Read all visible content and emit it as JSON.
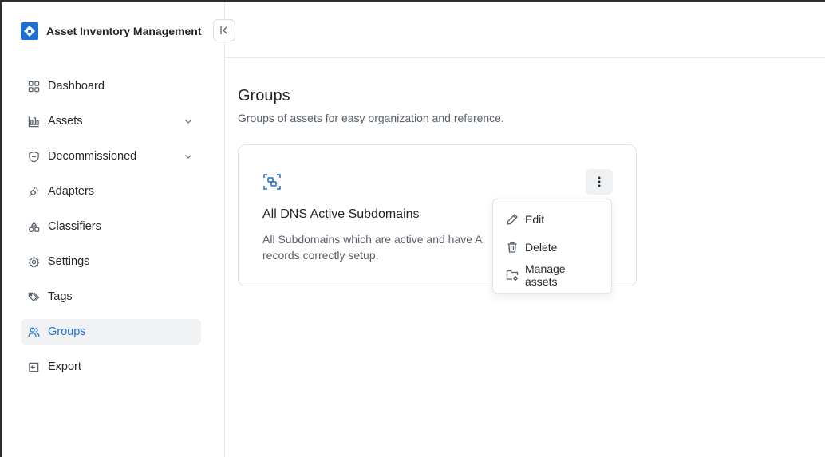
{
  "app": {
    "title": "Asset Inventory Management",
    "brand_color": "#1f6fd1"
  },
  "sidebar": {
    "items": [
      {
        "label": "Dashboard",
        "icon": "grid-icon",
        "expandable": false,
        "active": false
      },
      {
        "label": "Assets",
        "icon": "chart-icon",
        "expandable": true,
        "active": false
      },
      {
        "label": "Decommissioned",
        "icon": "shield-icon",
        "expandable": true,
        "active": false
      },
      {
        "label": "Adapters",
        "icon": "plug-icon",
        "expandable": false,
        "active": false
      },
      {
        "label": "Classifiers",
        "icon": "shapes-icon",
        "expandable": false,
        "active": false
      },
      {
        "label": "Settings",
        "icon": "gear-icon",
        "expandable": false,
        "active": false
      },
      {
        "label": "Tags",
        "icon": "tags-icon",
        "expandable": false,
        "active": false
      },
      {
        "label": "Groups",
        "icon": "users-icon",
        "expandable": false,
        "active": true
      },
      {
        "label": "Export",
        "icon": "export-icon",
        "expandable": false,
        "active": false
      }
    ]
  },
  "main": {
    "title": "Groups",
    "subtitle": "Groups of assets for easy organization and reference."
  },
  "group_card": {
    "icon": "group-icon",
    "title": "All DNS Active Subdomains",
    "description": "All Subdomains which are active and have A records correctly setup."
  },
  "context_menu": {
    "items": [
      {
        "label": "Edit",
        "icon": "pencil-icon"
      },
      {
        "label": "Delete",
        "icon": "trash-icon"
      },
      {
        "label": "Manage assets",
        "icon": "folder-settings-icon"
      }
    ]
  }
}
